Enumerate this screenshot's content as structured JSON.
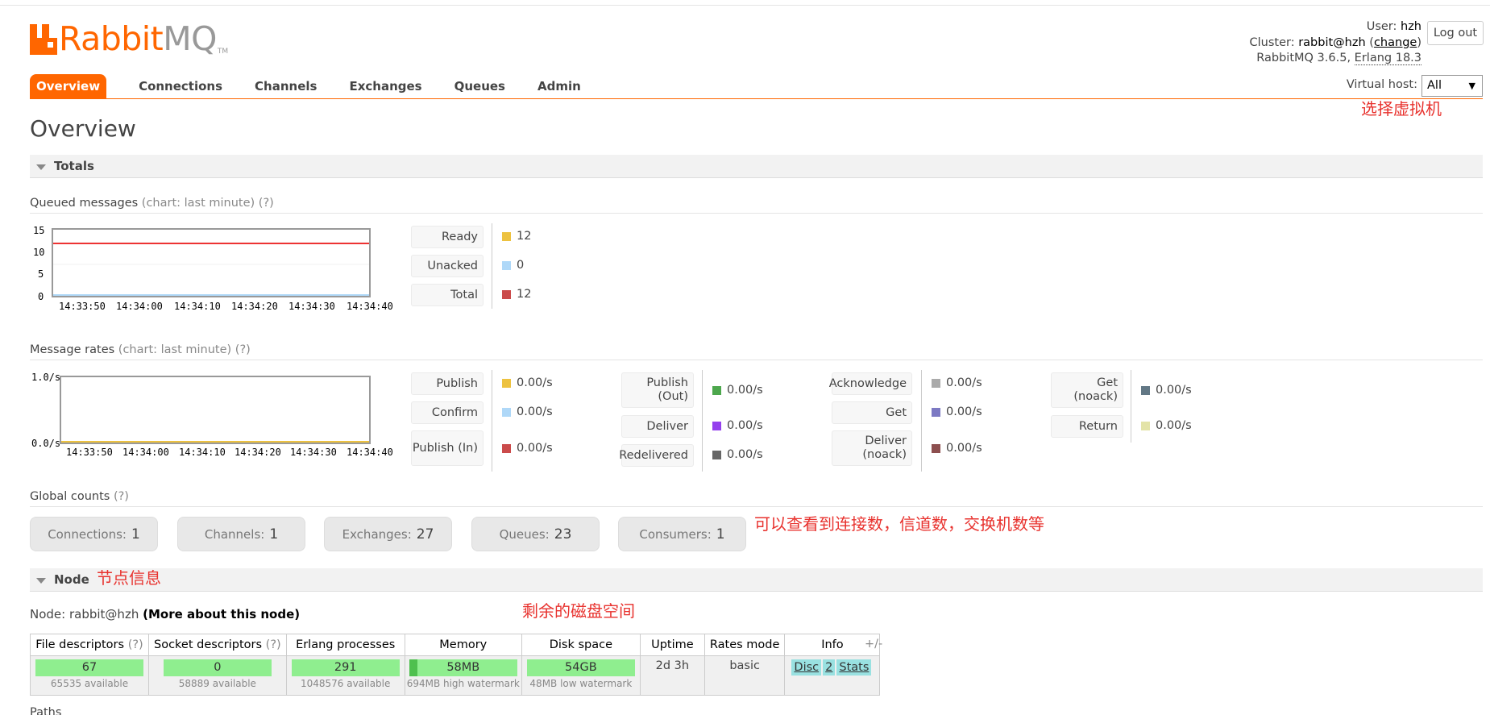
{
  "logo": {
    "rabbit": "Rabbit",
    "mq": "MQ",
    "tm": "TM"
  },
  "header": {
    "user_label": "User:",
    "user": "hzh",
    "cluster_label": "Cluster:",
    "cluster": "rabbit@hzh",
    "change": "change",
    "version": "RabbitMQ 3.6.5,",
    "erlang": "Erlang 18.3",
    "logout": "Log out"
  },
  "tabs": [
    "Overview",
    "Connections",
    "Channels",
    "Exchanges",
    "Queues",
    "Admin"
  ],
  "vhost": {
    "label": "Virtual host:",
    "value": "All",
    "arrow": "▼"
  },
  "annotations": {
    "vhost": "选择虚拟机",
    "global": "可以查看到连接数，信道数，交换机数等",
    "node": "节点信息",
    "disk": "剩余的磁盘空间"
  },
  "page_title": "Overview",
  "totals": {
    "title": "Totals"
  },
  "queued": {
    "title": "Queued messages",
    "chart_note": "(chart: last minute)",
    "help": "(?)",
    "y_ticks": [
      "15",
      "10",
      "5",
      "0"
    ],
    "x_ticks": [
      "14:33:50",
      "14:34:00",
      "14:34:10",
      "14:34:20",
      "14:34:30",
      "14:34:40"
    ],
    "legend": [
      {
        "label": "Ready",
        "value": "12",
        "color": "#edc240"
      },
      {
        "label": "Unacked",
        "value": "0",
        "color": "#afd8f8"
      },
      {
        "label": "Total",
        "value": "12",
        "color": "#cb4b4b"
      }
    ]
  },
  "rates": {
    "title": "Message rates",
    "chart_note": "(chart: last minute)",
    "help": "(?)",
    "y_ticks": [
      "1.0/s",
      "0.0/s"
    ],
    "x_ticks": [
      "14:33:50",
      "14:34:00",
      "14:34:10",
      "14:34:20",
      "14:34:30",
      "14:34:40"
    ],
    "col1": [
      {
        "label": "Publish",
        "value": "0.00/s",
        "color": "#edc240"
      },
      {
        "label": "Confirm",
        "value": "0.00/s",
        "color": "#afd8f8"
      },
      {
        "label": "Publish (In)",
        "value": "0.00/s",
        "color": "#cb4b4b"
      }
    ],
    "col2": [
      {
        "label": "Publish (Out)",
        "value": "0.00/s",
        "color": "#4da74d"
      },
      {
        "label": "Deliver",
        "value": "0.00/s",
        "color": "#9440ed"
      },
      {
        "label": "Redelivered",
        "value": "0.00/s",
        "color": "#666666"
      }
    ],
    "col3": [
      {
        "label": "Acknowledge",
        "value": "0.00/s",
        "color": "#aaaaaa"
      },
      {
        "label": "Get",
        "value": "0.00/s",
        "color": "#7c79c3"
      },
      {
        "label": "Deliver (noack)",
        "value": "0.00/s",
        "color": "#8d4f4f"
      }
    ],
    "col4": [
      {
        "label": "Get (noack)",
        "value": "0.00/s",
        "color": "#627885"
      },
      {
        "label": "Return",
        "value": "0.00/s",
        "color": "#e3e3a8"
      }
    ]
  },
  "global": {
    "title": "Global counts",
    "help": "(?)",
    "items": [
      {
        "label": "Connections:",
        "value": "1"
      },
      {
        "label": "Channels:",
        "value": "1"
      },
      {
        "label": "Exchanges:",
        "value": "27"
      },
      {
        "label": "Queues:",
        "value": "23"
      },
      {
        "label": "Consumers:",
        "value": "1"
      }
    ]
  },
  "node": {
    "title": "Node",
    "node_label": "Node:",
    "node_name": "rabbit@hzh",
    "more": "(More about this node)",
    "columns": [
      "File descriptors",
      "Socket descriptors",
      "Erlang processes",
      "Memory",
      "Disk space",
      "Uptime",
      "Rates mode",
      "Info"
    ],
    "help": "(?)",
    "file_desc": {
      "value": "67",
      "sub": "65535 available"
    },
    "socket_desc": {
      "value": "0",
      "sub": "58889 available"
    },
    "erlang_proc": {
      "value": "291",
      "sub": "1048576 available"
    },
    "memory": {
      "value": "58MB",
      "sub": "694MB high watermark"
    },
    "disk": {
      "value": "54GB",
      "sub": "48MB low watermark"
    },
    "uptime": "2d 3h",
    "rates_mode": "basic",
    "info": [
      "Disc",
      "2",
      "Stats"
    ],
    "plusminus": "+/-"
  },
  "paths": "Paths"
}
